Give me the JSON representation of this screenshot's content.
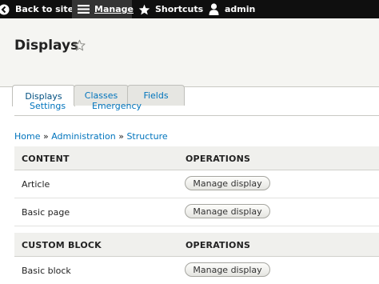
{
  "toolbar": {
    "back_label": "Back to site",
    "manage_label": "Manage",
    "shortcuts_label": "Shortcuts",
    "user_label": "admin"
  },
  "page": {
    "title": "Displays"
  },
  "tabs": {
    "primary": [
      "Displays",
      "Classes",
      "Fields"
    ],
    "secondary": [
      "Settings",
      "Emergency"
    ]
  },
  "breadcrumb": {
    "items": [
      "Home",
      "Administration",
      "Structure"
    ],
    "separator": "»"
  },
  "table": {
    "groups": [
      {
        "header": "CONTENT",
        "operations_header": "OPERATIONS",
        "rows": [
          {
            "name": "Article",
            "action": "Manage display"
          },
          {
            "name": "Basic page",
            "action": "Manage display"
          }
        ]
      },
      {
        "header": "CUSTOM BLOCK",
        "operations_header": "OPERATIONS",
        "rows": [
          {
            "name": "Basic block",
            "action": "Manage display"
          }
        ]
      }
    ]
  },
  "colors": {
    "toolbar_bg": "#0f0f0f",
    "link": "#0074bd",
    "header_bg": "#f5f5f2"
  },
  "icons": [
    "back-arrow-icon",
    "hamburger-menu-icon",
    "star-icon",
    "user-icon",
    "favorite-star-icon"
  ]
}
